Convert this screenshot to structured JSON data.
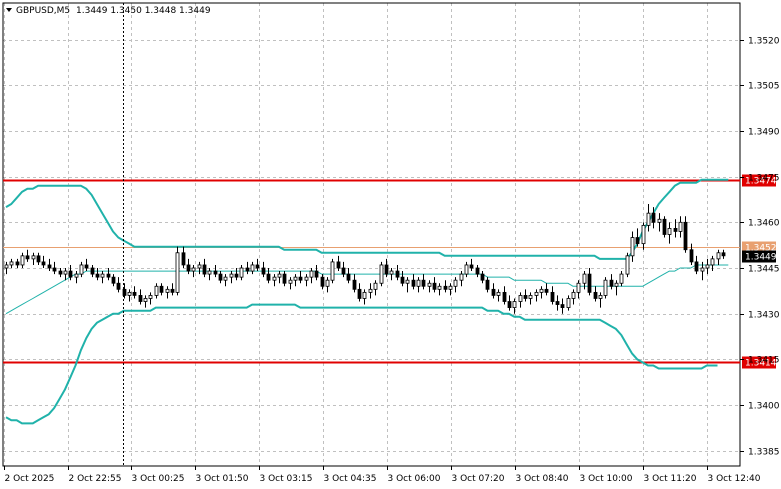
{
  "header": {
    "symbol": "GBPUSD,M5",
    "ohlc": "1.3449 1.3450 1.3448 1.3449"
  },
  "colors": {
    "background": "#ffffff",
    "grid": "#c0c0c0",
    "candle": "#000000",
    "bollinger": "#20b2aa",
    "level_line": "#e00000",
    "price_line": "#e8a070",
    "current_price_bg": "#000000",
    "current_price_fg": "#ffffff"
  },
  "chart_data": {
    "type": "candlestick",
    "symbol": "GBPUSD",
    "timeframe": "M5",
    "ylim": [
      1.338,
      1.3532
    ],
    "y_ticks": [
      "1.3520",
      "1.3505",
      "1.3490",
      "1.3475",
      "1.3460",
      "1.3445",
      "1.3430",
      "1.3415",
      "1.3400",
      "1.3385"
    ],
    "x_ticks": [
      "2 Oct 2025",
      "2 Oct 22:55",
      "3 Oct 00:25",
      "3 Oct 01:50",
      "3 Oct 03:15",
      "3 Oct 04:35",
      "3 Oct 06:00",
      "3 Oct 07:20",
      "3 Oct 08:40",
      "3 Oct 10:00",
      "3 Oct 11:20",
      "3 Oct 12:40"
    ],
    "grid": true,
    "horizontal_levels": [
      {
        "value": 1.3474,
        "label": "1.3474",
        "style": "resistance"
      },
      {
        "value": 1.3414,
        "label": "1.3414",
        "style": "support"
      },
      {
        "value": 1.3452,
        "label": "1.3452",
        "style": "price"
      }
    ],
    "current_price": {
      "value": 1.3449,
      "label": "1.3449"
    },
    "period_separator_x_index": 23,
    "candles": [
      [
        1.3445,
        1.3447,
        1.3443,
        1.3446
      ],
      [
        1.3446,
        1.3448,
        1.3445,
        1.3447
      ],
      [
        1.3447,
        1.3448,
        1.3445,
        1.3446
      ],
      [
        1.3446,
        1.345,
        1.3445,
        1.3449
      ],
      [
        1.3449,
        1.3451,
        1.3447,
        1.3448
      ],
      [
        1.3448,
        1.345,
        1.3446,
        1.3449
      ],
      [
        1.3449,
        1.345,
        1.3446,
        1.3447
      ],
      [
        1.3447,
        1.3449,
        1.3445,
        1.3446
      ],
      [
        1.3446,
        1.3448,
        1.3444,
        1.3445
      ],
      [
        1.3445,
        1.3447,
        1.3443,
        1.3444
      ],
      [
        1.3444,
        1.3445,
        1.3442,
        1.3443
      ],
      [
        1.3443,
        1.3445,
        1.3441,
        1.3444
      ],
      [
        1.3444,
        1.3446,
        1.3441,
        1.3442
      ],
      [
        1.3442,
        1.3444,
        1.344,
        1.3443
      ],
      [
        1.3443,
        1.3447,
        1.3442,
        1.3446
      ],
      [
        1.3446,
        1.3448,
        1.3444,
        1.3445
      ],
      [
        1.3445,
        1.3446,
        1.3442,
        1.3443
      ],
      [
        1.3443,
        1.3445,
        1.3441,
        1.3442
      ],
      [
        1.3442,
        1.3444,
        1.344,
        1.3443
      ],
      [
        1.3443,
        1.3445,
        1.3441,
        1.3442
      ],
      [
        1.3442,
        1.3443,
        1.3439,
        1.344
      ],
      [
        1.344,
        1.3442,
        1.3437,
        1.3438
      ],
      [
        1.3438,
        1.344,
        1.3435,
        1.3436
      ],
      [
        1.3436,
        1.3438,
        1.3434,
        1.3437
      ],
      [
        1.3437,
        1.3439,
        1.3435,
        1.3436
      ],
      [
        1.3436,
        1.3438,
        1.3433,
        1.3434
      ],
      [
        1.3434,
        1.3436,
        1.3432,
        1.3435
      ],
      [
        1.3435,
        1.3437,
        1.3433,
        1.3436
      ],
      [
        1.3436,
        1.344,
        1.3435,
        1.3439
      ],
      [
        1.3439,
        1.344,
        1.3436,
        1.3437
      ],
      [
        1.3437,
        1.3439,
        1.3435,
        1.3438
      ],
      [
        1.3438,
        1.344,
        1.3436,
        1.3437
      ],
      [
        1.3437,
        1.3452,
        1.3436,
        1.345
      ],
      [
        1.345,
        1.3452,
        1.3445,
        1.3446
      ],
      [
        1.3446,
        1.3448,
        1.3443,
        1.3444
      ],
      [
        1.3444,
        1.3446,
        1.3442,
        1.3445
      ],
      [
        1.3445,
        1.3447,
        1.3443,
        1.3446
      ],
      [
        1.3446,
        1.3448,
        1.3442,
        1.3443
      ],
      [
        1.3443,
        1.3445,
        1.3441,
        1.3444
      ],
      [
        1.3444,
        1.3446,
        1.3442,
        1.3443
      ],
      [
        1.3443,
        1.3444,
        1.344,
        1.3441
      ],
      [
        1.3441,
        1.3443,
        1.3439,
        1.3442
      ],
      [
        1.3442,
        1.3444,
        1.344,
        1.3443
      ],
      [
        1.3443,
        1.3445,
        1.3441,
        1.3442
      ],
      [
        1.3442,
        1.3446,
        1.3441,
        1.3445
      ],
      [
        1.3445,
        1.3447,
        1.3443,
        1.3444
      ],
      [
        1.3444,
        1.3447,
        1.3443,
        1.3446
      ],
      [
        1.3446,
        1.3448,
        1.3444,
        1.3445
      ],
      [
        1.3445,
        1.3447,
        1.3442,
        1.3443
      ],
      [
        1.3443,
        1.3445,
        1.344,
        1.3441
      ],
      [
        1.3441,
        1.3443,
        1.3439,
        1.3442
      ],
      [
        1.3442,
        1.3444,
        1.344,
        1.3443
      ],
      [
        1.3443,
        1.3444,
        1.3439,
        1.344
      ],
      [
        1.344,
        1.3442,
        1.3438,
        1.3441
      ],
      [
        1.3441,
        1.3443,
        1.3439,
        1.3442
      ],
      [
        1.3442,
        1.3444,
        1.344,
        1.3441
      ],
      [
        1.3441,
        1.3443,
        1.3439,
        1.3442
      ],
      [
        1.3442,
        1.3445,
        1.344,
        1.3444
      ],
      [
        1.3444,
        1.3446,
        1.3441,
        1.3442
      ],
      [
        1.3442,
        1.3443,
        1.3438,
        1.3439
      ],
      [
        1.3439,
        1.3442,
        1.3437,
        1.3441
      ],
      [
        1.3441,
        1.3448,
        1.344,
        1.3447
      ],
      [
        1.3447,
        1.3449,
        1.3444,
        1.3445
      ],
      [
        1.3445,
        1.3447,
        1.3442,
        1.3443
      ],
      [
        1.3443,
        1.3445,
        1.344,
        1.3441
      ],
      [
        1.3441,
        1.3443,
        1.3437,
        1.3438
      ],
      [
        1.3438,
        1.344,
        1.3434,
        1.3435
      ],
      [
        1.3435,
        1.3438,
        1.3433,
        1.3437
      ],
      [
        1.3437,
        1.344,
        1.3435,
        1.3438
      ],
      [
        1.3438,
        1.3441,
        1.3436,
        1.344
      ],
      [
        1.344,
        1.3447,
        1.3439,
        1.3446
      ],
      [
        1.3446,
        1.3448,
        1.3442,
        1.3443
      ],
      [
        1.3443,
        1.3445,
        1.3441,
        1.3444
      ],
      [
        1.3444,
        1.3446,
        1.3441,
        1.3442
      ],
      [
        1.3442,
        1.3444,
        1.3439,
        1.344
      ],
      [
        1.344,
        1.3442,
        1.3437,
        1.3441
      ],
      [
        1.3441,
        1.3443,
        1.3438,
        1.3439
      ],
      [
        1.3439,
        1.3442,
        1.3437,
        1.3441
      ],
      [
        1.3441,
        1.3443,
        1.3438,
        1.3439
      ],
      [
        1.3439,
        1.3441,
        1.3437,
        1.344
      ],
      [
        1.344,
        1.3442,
        1.3437,
        1.3438
      ],
      [
        1.3438,
        1.344,
        1.3436,
        1.3439
      ],
      [
        1.3439,
        1.3441,
        1.3437,
        1.3438
      ],
      [
        1.3438,
        1.344,
        1.3436,
        1.3439
      ],
      [
        1.3439,
        1.3442,
        1.3437,
        1.3441
      ],
      [
        1.3441,
        1.3444,
        1.3439,
        1.3443
      ],
      [
        1.3443,
        1.3447,
        1.3442,
        1.3446
      ],
      [
        1.3446,
        1.3448,
        1.3444,
        1.3445
      ],
      [
        1.3445,
        1.3446,
        1.3442,
        1.3443
      ],
      [
        1.3443,
        1.3444,
        1.344,
        1.3441
      ],
      [
        1.3441,
        1.3442,
        1.3437,
        1.3438
      ],
      [
        1.3438,
        1.344,
        1.3435,
        1.3436
      ],
      [
        1.3436,
        1.3438,
        1.3434,
        1.3437
      ],
      [
        1.3437,
        1.3439,
        1.3433,
        1.3434
      ],
      [
        1.3434,
        1.3436,
        1.3431,
        1.3432
      ],
      [
        1.3432,
        1.3435,
        1.343,
        1.3434
      ],
      [
        1.3434,
        1.3437,
        1.3432,
        1.3436
      ],
      [
        1.3436,
        1.3438,
        1.3434,
        1.3435
      ],
      [
        1.3435,
        1.3437,
        1.3433,
        1.3436
      ],
      [
        1.3436,
        1.3438,
        1.3434,
        1.3437
      ],
      [
        1.3437,
        1.3439,
        1.3435,
        1.3438
      ],
      [
        1.3438,
        1.344,
        1.3436,
        1.3437
      ],
      [
        1.3437,
        1.3439,
        1.3433,
        1.3434
      ],
      [
        1.3434,
        1.3436,
        1.3431,
        1.3433
      ],
      [
        1.3433,
        1.3435,
        1.343,
        1.3432
      ],
      [
        1.3432,
        1.3436,
        1.3431,
        1.3435
      ],
      [
        1.3435,
        1.3438,
        1.3433,
        1.3437
      ],
      [
        1.3437,
        1.3441,
        1.3435,
        1.344
      ],
      [
        1.344,
        1.3444,
        1.3438,
        1.3443
      ],
      [
        1.3443,
        1.3445,
        1.3436,
        1.3437
      ],
      [
        1.3437,
        1.3439,
        1.3434,
        1.3435
      ],
      [
        1.3435,
        1.3437,
        1.3432,
        1.3436
      ],
      [
        1.3436,
        1.3442,
        1.3435,
        1.3441
      ],
      [
        1.3441,
        1.3443,
        1.3438,
        1.3439
      ],
      [
        1.3439,
        1.3441,
        1.3436,
        1.344
      ],
      [
        1.344,
        1.3444,
        1.3439,
        1.3443
      ],
      [
        1.3443,
        1.345,
        1.3442,
        1.3449
      ],
      [
        1.3449,
        1.3457,
        1.3447,
        1.3455
      ],
      [
        1.3455,
        1.3458,
        1.3452,
        1.3453
      ],
      [
        1.3453,
        1.346,
        1.3451,
        1.3459
      ],
      [
        1.3459,
        1.3466,
        1.3457,
        1.3463
      ],
      [
        1.3463,
        1.3465,
        1.3458,
        1.346
      ],
      [
        1.346,
        1.3463,
        1.3457,
        1.3461
      ],
      [
        1.3461,
        1.3462,
        1.3455,
        1.3456
      ],
      [
        1.3456,
        1.346,
        1.3453,
        1.3458
      ],
      [
        1.3458,
        1.3461,
        1.3455,
        1.3457
      ],
      [
        1.3457,
        1.3462,
        1.3455,
        1.346
      ],
      [
        1.346,
        1.3462,
        1.345,
        1.3451
      ],
      [
        1.3451,
        1.3453,
        1.3446,
        1.3447
      ],
      [
        1.3447,
        1.3449,
        1.3443,
        1.3444
      ],
      [
        1.3444,
        1.3447,
        1.3441,
        1.3445
      ],
      [
        1.3445,
        1.3448,
        1.3443,
        1.3446
      ],
      [
        1.3446,
        1.3449,
        1.3444,
        1.3448
      ],
      [
        1.3448,
        1.3451,
        1.3446,
        1.345
      ],
      [
        1.345,
        1.3451,
        1.3448,
        1.3449
      ]
    ],
    "bollinger_upper": [
      1.3465,
      1.3466,
      1.3468,
      1.347,
      1.3471,
      1.3471,
      1.3472,
      1.3472,
      1.3472,
      1.3472,
      1.3472,
      1.3472,
      1.3472,
      1.3472,
      1.3472,
      1.3471,
      1.3469,
      1.3466,
      1.3463,
      1.346,
      1.3457,
      1.3455,
      1.3454,
      1.3453,
      1.3452,
      1.3452,
      1.3452,
      1.3452,
      1.3452,
      1.3452,
      1.3452,
      1.3452,
      1.3452,
      1.3452,
      1.3452,
      1.3452,
      1.3452,
      1.3452,
      1.3452,
      1.3452,
      1.3452,
      1.3452,
      1.3452,
      1.3452,
      1.3452,
      1.3452,
      1.3452,
      1.3452,
      1.3452,
      1.3452,
      1.3452,
      1.3452,
      1.3451,
      1.3451,
      1.3451,
      1.3451,
      1.3451,
      1.3451,
      1.3451,
      1.345,
      1.345,
      1.345,
      1.345,
      1.345,
      1.345,
      1.345,
      1.345,
      1.345,
      1.345,
      1.345,
      1.345,
      1.345,
      1.345,
      1.345,
      1.345,
      1.345,
      1.345,
      1.345,
      1.345,
      1.345,
      1.345,
      1.345,
      1.3449,
      1.3449,
      1.3449,
      1.3449,
      1.3449,
      1.3449,
      1.3449,
      1.3449,
      1.3449,
      1.3449,
      1.3449,
      1.3449,
      1.3449,
      1.3449,
      1.3449,
      1.3449,
      1.3449,
      1.3449,
      1.3449,
      1.3449,
      1.3449,
      1.3449,
      1.3449,
      1.3449,
      1.3449,
      1.3449,
      1.3449,
      1.3449,
      1.3449,
      1.3448,
      1.3448,
      1.3448,
      1.3448,
      1.3448,
      1.3448,
      1.345,
      1.3453,
      1.3457,
      1.346,
      1.3463,
      1.3466,
      1.3468,
      1.347,
      1.3472,
      1.3473,
      1.3473,
      1.3473,
      1.3473,
      1.3474,
      1.3474,
      1.3474,
      1.3474,
      1.3474,
      1.3474
    ],
    "bollinger_middle": [
      1.343,
      1.3431,
      1.3432,
      1.3433,
      1.3434,
      1.3435,
      1.3436,
      1.3437,
      1.3438,
      1.3439,
      1.344,
      1.3441,
      1.3442,
      1.3443,
      1.3443,
      1.3444,
      1.3444,
      1.3444,
      1.3444,
      1.3444,
      1.3444,
      1.3444,
      1.3444,
      1.3444,
      1.3444,
      1.3444,
      1.3444,
      1.3444,
      1.3444,
      1.3444,
      1.3444,
      1.3444,
      1.3444,
      1.3444,
      1.3444,
      1.3444,
      1.3444,
      1.3444,
      1.3444,
      1.3444,
      1.3444,
      1.3444,
      1.3444,
      1.3444,
      1.3444,
      1.3444,
      1.3444,
      1.3444,
      1.3444,
      1.3444,
      1.3444,
      1.3444,
      1.3444,
      1.3444,
      1.3444,
      1.3444,
      1.3444,
      1.3444,
      1.3444,
      1.3443,
      1.3443,
      1.3443,
      1.3443,
      1.3443,
      1.3443,
      1.3443,
      1.3443,
      1.3443,
      1.3443,
      1.3443,
      1.3443,
      1.3443,
      1.3443,
      1.3443,
      1.3443,
      1.3443,
      1.3443,
      1.3443,
      1.3443,
      1.3443,
      1.3443,
      1.3443,
      1.3443,
      1.3443,
      1.3443,
      1.3443,
      1.3443,
      1.3443,
      1.3443,
      1.3443,
      1.3442,
      1.3442,
      1.3442,
      1.3442,
      1.3442,
      1.3441,
      1.3441,
      1.3441,
      1.3441,
      1.3441,
      1.3441,
      1.344,
      1.344,
      1.344,
      1.344,
      1.344,
      1.3439,
      1.3439,
      1.3439,
      1.3439,
      1.3439,
      1.3439,
      1.3439,
      1.3439,
      1.3439,
      1.3439,
      1.3439,
      1.3439,
      1.3439,
      1.3439,
      1.344,
      1.3441,
      1.3442,
      1.3443,
      1.3444,
      1.3444,
      1.3445,
      1.3445,
      1.3445,
      1.3446,
      1.3446,
      1.3446,
      1.3446,
      1.3446,
      1.3446,
      1.3446
    ],
    "bollinger_lower": [
      1.3396,
      1.3395,
      1.3395,
      1.3394,
      1.3394,
      1.3394,
      1.3395,
      1.3396,
      1.3397,
      1.3399,
      1.3402,
      1.3405,
      1.3409,
      1.3413,
      1.3418,
      1.3422,
      1.3425,
      1.3427,
      1.3428,
      1.3429,
      1.343,
      1.343,
      1.3431,
      1.3431,
      1.3431,
      1.3431,
      1.3431,
      1.3431,
      1.3432,
      1.3432,
      1.3432,
      1.3432,
      1.3432,
      1.3432,
      1.3432,
      1.3432,
      1.3432,
      1.3432,
      1.3432,
      1.3432,
      1.3432,
      1.3432,
      1.3432,
      1.3432,
      1.3432,
      1.3432,
      1.3433,
      1.3433,
      1.3433,
      1.3433,
      1.3433,
      1.3433,
      1.3433,
      1.3433,
      1.3433,
      1.3432,
      1.3432,
      1.3432,
      1.3432,
      1.3432,
      1.3432,
      1.3432,
      1.3432,
      1.3432,
      1.3432,
      1.3432,
      1.3432,
      1.3432,
      1.3432,
      1.3432,
      1.3432,
      1.3432,
      1.3432,
      1.3432,
      1.3432,
      1.3432,
      1.3432,
      1.3432,
      1.3432,
      1.3432,
      1.3432,
      1.3432,
      1.3432,
      1.3432,
      1.3432,
      1.3432,
      1.3432,
      1.3432,
      1.3432,
      1.3432,
      1.3431,
      1.3431,
      1.3431,
      1.343,
      1.343,
      1.3429,
      1.3429,
      1.3428,
      1.3428,
      1.3428,
      1.3428,
      1.3428,
      1.3428,
      1.3428,
      1.3428,
      1.3428,
      1.3428,
      1.3428,
      1.3428,
      1.3428,
      1.3428,
      1.3428,
      1.3427,
      1.3426,
      1.3425,
      1.3423,
      1.342,
      1.3417,
      1.3415,
      1.3414,
      1.3413,
      1.3413,
      1.3412,
      1.3412,
      1.3412,
      1.3412,
      1.3412,
      1.3412,
      1.3412,
      1.3412,
      1.3412,
      1.3413,
      1.3413,
      1.3413
    ]
  }
}
